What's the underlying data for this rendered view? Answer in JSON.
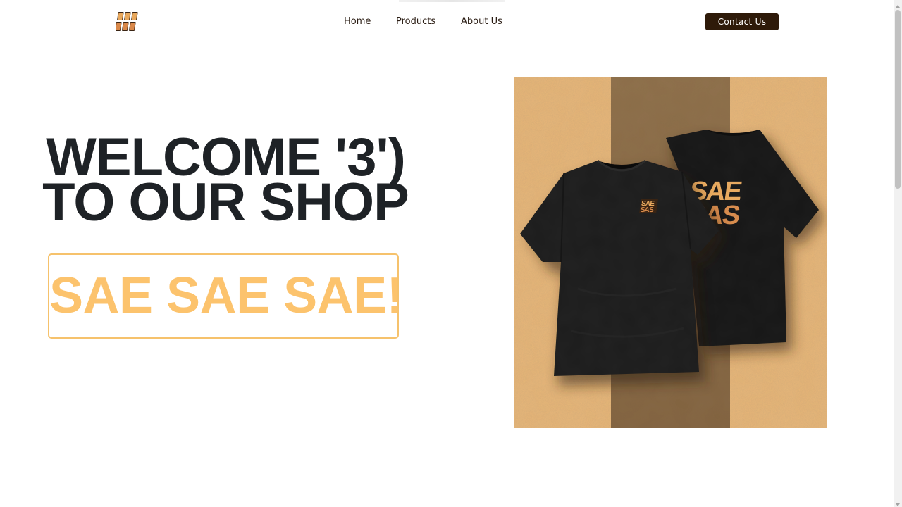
{
  "header": {
    "logo_icon": "sae-sae-logo",
    "nav": {
      "home": "Home",
      "products": "Products",
      "about": "About Us"
    },
    "contact_label": "Contact Us"
  },
  "hero": {
    "title_line1": "WELCOME '3')",
    "title_line2": "TO OUR SHOP",
    "brand_text": "SAE SAE SAE!",
    "image_icon": "black-tshirt-product-photo"
  },
  "colors": {
    "heading": "#1e2226",
    "brand_yellow": "#fcc36d",
    "button_bg": "#2e1a09",
    "nav_text": "#2b1d14",
    "sand": "#e6b578",
    "stripe": "#7e6445"
  }
}
